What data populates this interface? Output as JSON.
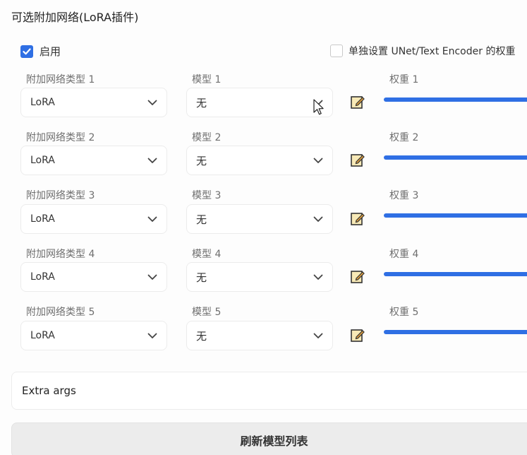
{
  "panel": {
    "title": "可选附加网络(LoRA插件)"
  },
  "enable": {
    "label": "启用",
    "checked": true
  },
  "separate_weights": {
    "label": "单独设置 UNet/Text Encoder 的权重",
    "checked": false
  },
  "networks": [
    {
      "type_label": "附加网络类型 1",
      "type_value": "LoRA",
      "model_label": "模型 1",
      "model_value": "无",
      "weight_label": "权重 1"
    },
    {
      "type_label": "附加网络类型 2",
      "type_value": "LoRA",
      "model_label": "模型 2",
      "model_value": "无",
      "weight_label": "权重 2"
    },
    {
      "type_label": "附加网络类型 3",
      "type_value": "LoRA",
      "model_label": "模型 3",
      "model_value": "无",
      "weight_label": "权重 3"
    },
    {
      "type_label": "附加网络类型 4",
      "type_value": "LoRA",
      "model_label": "模型 4",
      "model_value": "无",
      "weight_label": "权重 4"
    },
    {
      "type_label": "附加网络类型 5",
      "type_value": "LoRA",
      "model_label": "模型 5",
      "model_value": "无",
      "weight_label": "权重 5"
    }
  ],
  "extra_args": {
    "label": "Extra args"
  },
  "refresh_button": {
    "label": "刷新模型列表"
  },
  "colors": {
    "accent": "#2f6fe4",
    "border": "#ececec"
  },
  "icons": {
    "chevron": "chevron-down-icon",
    "edit": "edit-note-icon",
    "check": "check-icon",
    "cursor": "mouse-pointer-icon"
  }
}
